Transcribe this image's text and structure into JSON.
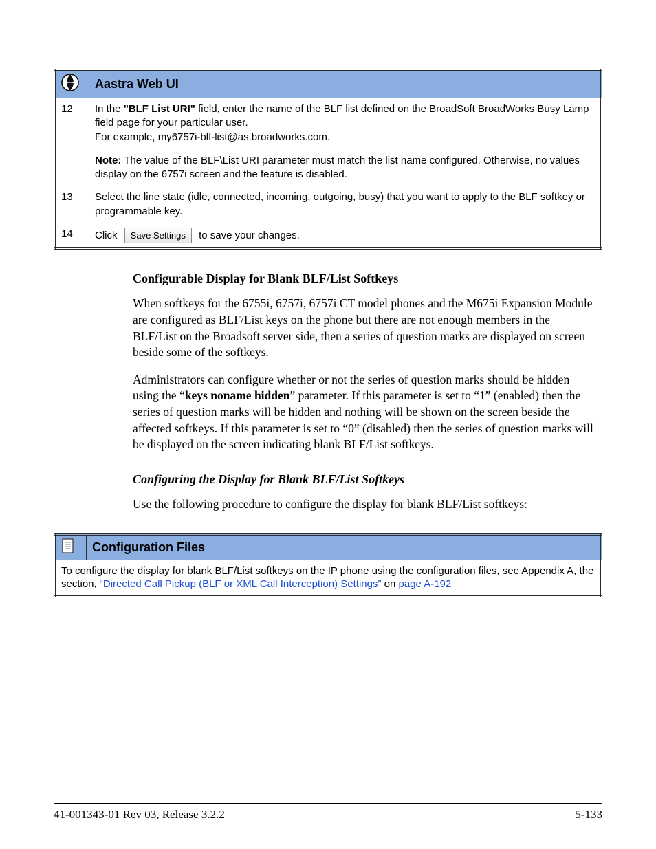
{
  "table1": {
    "title": "Aastra Web UI",
    "rows": [
      {
        "num": "12",
        "p1_a": "In the ",
        "p1_b": "\"BLF List URI\"",
        "p1_c": " field, enter the name of the BLF list defined on the BroadSoft BroadWorks Busy Lamp field page for your particular user.",
        "p2": "For example, my6757i-blf-list@as.broadworks.com.",
        "p3_a": "Note:",
        "p3_b": " The value of the BLF\\List URI parameter must match the list name configured. Otherwise, no values display on the 6757i screen and the feature is disabled."
      },
      {
        "num": "13",
        "text": "Select the line state (idle, connected, incoming, outgoing, busy) that you want to apply to the BLF softkey or programmable key."
      },
      {
        "num": "14",
        "pre": "Click",
        "btn": "Save Settings",
        "post": "to save your changes."
      }
    ]
  },
  "sections": {
    "h1": "Configurable Display for Blank BLF/List Softkeys",
    "p1": "When softkeys for the 6755i, 6757i, 6757i CT model phones and the M675i Expansion Module are configured as BLF/List keys on the phone but there are not enough members in the BLF/List on the Broadsoft server side, then a series of question marks are displayed on screen beside some of the softkeys.",
    "p2_a": "Administrators can configure whether or not the series of question marks should be hidden using the “",
    "p2_b": "keys noname hidden",
    "p2_c": "” parameter. If this parameter is set to “1” (enabled) then the series of question marks will be hidden and nothing will be shown on the screen beside the affected softkeys. If this parameter is set to “0” (disabled) then the series of question marks will be displayed on the screen indicating blank BLF/List softkeys.",
    "h2": "Configuring the Display for Blank BLF/List Softkeys",
    "p3": "Use the following procedure to configure the display for blank BLF/List softkeys:"
  },
  "table2": {
    "title": "Configuration Files",
    "body_a": "To configure the display for blank BLF/List softkeys on the IP phone using the configuration files, see Appendix A, the section, ",
    "link": "“Directed Call Pickup (BLF or XML Call Interception) Settings”",
    "body_b": " on ",
    "page_link": "page A-192"
  },
  "footer": {
    "left": "41-001343-01 Rev 03, Release 3.2.2",
    "right": "5-133"
  }
}
